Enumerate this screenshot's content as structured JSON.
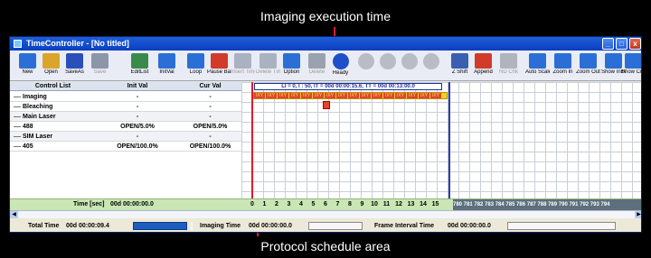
{
  "captions": {
    "top": "Imaging execution time",
    "bottom": "Protocol schedule area"
  },
  "window": {
    "title": "TimeController - [No titled]",
    "controls": {
      "minimize": "_",
      "maximize": "□",
      "close": "x"
    }
  },
  "toolbar": {
    "buttons": [
      {
        "label": "New",
        "icon": "new-file-icon",
        "enabled": true
      },
      {
        "label": "Open",
        "icon": "open-folder-icon",
        "enabled": true
      },
      {
        "label": "SaveAs",
        "icon": "save-as-icon",
        "enabled": true
      },
      {
        "label": "Save",
        "icon": "save-icon",
        "enabled": false
      },
      {
        "label": "EditList",
        "icon": "edit-list-icon",
        "enabled": true
      },
      {
        "label": "InitVal",
        "icon": "init-val-icon",
        "enabled": true
      },
      {
        "label": "Loop",
        "icon": "loop-icon",
        "enabled": true
      },
      {
        "label": "Pause Bar",
        "icon": "pause-bar-icon",
        "enabled": true
      },
      {
        "label": "Insert Time",
        "icon": "insert-time-icon",
        "enabled": false
      },
      {
        "label": "Delete Time",
        "icon": "delete-time-icon",
        "enabled": false
      },
      {
        "label": "Option",
        "icon": "option-icon",
        "enabled": true
      },
      {
        "label": "Delete",
        "icon": "delete-icon",
        "enabled": false
      },
      {
        "label": "Ready",
        "icon": "ready-icon",
        "enabled": true
      },
      {
        "label": "",
        "icon": "run-indicator-icon",
        "enabled": false
      },
      {
        "label": "",
        "icon": "run-indicator-icon",
        "enabled": false
      },
      {
        "label": "",
        "icon": "run-indicator-icon",
        "enabled": false
      },
      {
        "label": "",
        "icon": "run-indicator-icon",
        "enabled": false
      },
      {
        "label": "Z Shift",
        "icon": "z-shift-icon",
        "enabled": true
      },
      {
        "label": "Append",
        "icon": "append-icon",
        "enabled": true
      },
      {
        "label": "ND Chk",
        "icon": "nd-check-icon",
        "enabled": false
      },
      {
        "label": "Auto Scale",
        "icon": "auto-scale-icon",
        "enabled": true
      },
      {
        "label": "Zoom In",
        "icon": "zoom-in-icon",
        "enabled": true
      },
      {
        "label": "Zoom Out",
        "icon": "zoom-out-icon",
        "enabled": true
      },
      {
        "label": "Show InitVal",
        "icon": "show-init-val-icon",
        "enabled": true
      },
      {
        "label": "Show CurVal",
        "icon": "show-cur-val-icon",
        "enabled": true
      }
    ]
  },
  "list": {
    "headers": [
      "Control List",
      "Init Val",
      "Cur Val"
    ],
    "rows": [
      {
        "name": "Imaging",
        "init": "-",
        "cur": "-",
        "group": false
      },
      {
        "name": "Bleaching",
        "init": "-",
        "cur": "-",
        "group": false
      },
      {
        "name": "Main Laser",
        "init": "-",
        "cur": "-",
        "group": true
      },
      {
        "name": "488",
        "init": "OPEN/5.0%",
        "cur": "OPEN/5.0%",
        "group": false
      },
      {
        "name": "SIM Laser",
        "init": "-",
        "cur": "-",
        "group": true
      },
      {
        "name": "405",
        "init": "OPEN/100.0%",
        "cur": "OPEN/100.0%",
        "group": false
      }
    ]
  },
  "schedule": {
    "timeline_text": "LI = 0, I : 50, IT = 00d 00:00:15.6, TT = 00d 00:13:00.0",
    "imaging_cell_label": "IXY",
    "time_label": "Time [sec]",
    "time_value": "00d 00:00:00.0",
    "ticks": [
      "0",
      "1",
      "2",
      "3",
      "4",
      "5",
      "6",
      "7",
      "8",
      "9",
      "10",
      "11",
      "12",
      "13",
      "14",
      "15"
    ],
    "ticks_right": "780 781 782 783 784 785 786 787 788 789 790 791 792 793 794"
  },
  "status": {
    "total_time_label": "Total Time",
    "total_time_value": "00d 00:00:09.4",
    "imaging_time_label": "Imaging Time",
    "imaging_time_value": "00d 00:00:00.0",
    "frame_interval_label": "Frame Interval Time",
    "frame_interval_value": "00d 00:00:00.0"
  },
  "colors": {
    "accent_red": "#e3192a",
    "frame_blue": "#2c3ea8",
    "imaging_yellow": "#f2d21a",
    "imaging_red": "#e24429",
    "time_row_green": "#c9e6b4"
  }
}
